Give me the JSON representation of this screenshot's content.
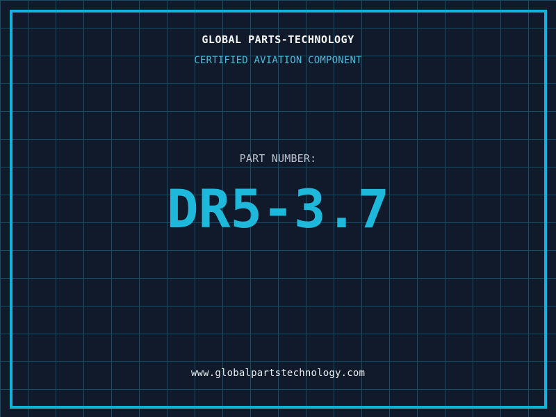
{
  "brand": {
    "title": "GLOBAL PARTS-TECHNOLOGY",
    "subtitle": "CERTIFIED AVIATION COMPONENT"
  },
  "part": {
    "label": "PART NUMBER:",
    "number": "DR5-3.7"
  },
  "footer": {
    "website": "www.globalpartstechnology.com"
  },
  "colors": {
    "background": "#101a2b",
    "grid_line": "#1d4c62",
    "frame_border": "#13b2d8",
    "title": "#f5f7f9",
    "subtitle": "#4db9d8",
    "part_label": "#b9c0ca",
    "part_number": "#1db8da",
    "website": "#e9edf1"
  }
}
